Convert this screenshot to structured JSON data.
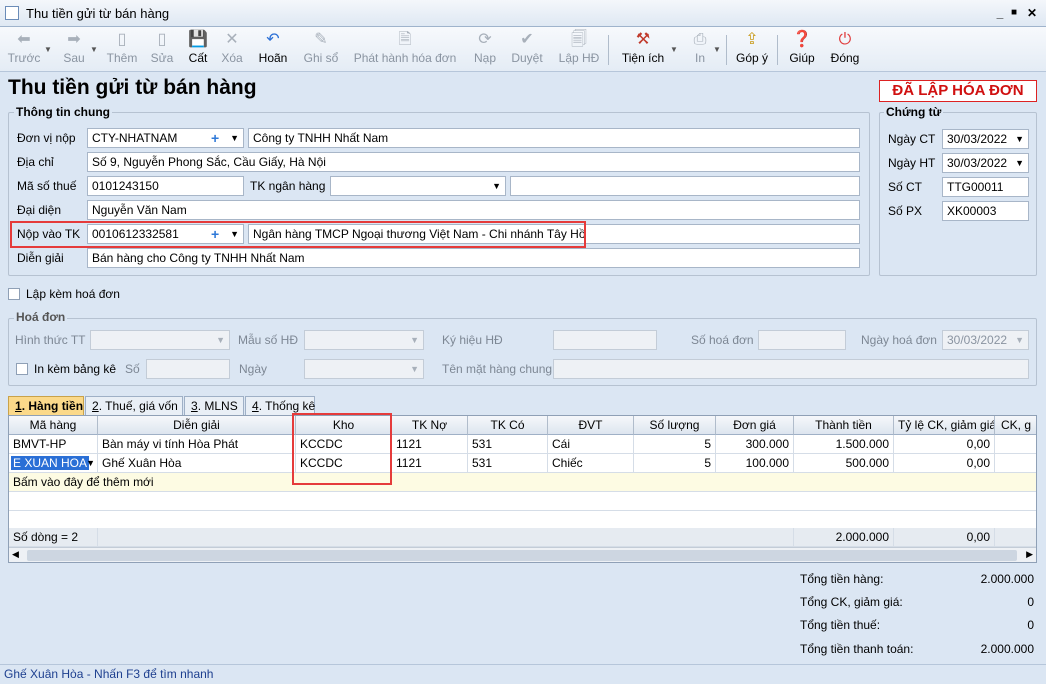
{
  "window": {
    "title": "Thu tiền gửi từ bán hàng",
    "controls": {
      "minimize": "_",
      "maximize": "■",
      "close": "✕"
    }
  },
  "toolbar": {
    "back": "Trước",
    "forward": "Sau",
    "add": "Thêm",
    "edit": "Sửa",
    "save": "Cất",
    "delete": "Xóa",
    "undo": "Hoãn",
    "post": "Ghi sổ",
    "issue_invoice": "Phát hành hóa đơn",
    "reload": "Nạp",
    "approve": "Duyệt",
    "create_invoice": "Lập HĐ",
    "utilities": "Tiện ích",
    "print": "In",
    "feedback": "Góp ý",
    "help": "Giúp",
    "close": "Đóng"
  },
  "page_title": "Thu tiền gửi từ bán hàng",
  "status_stamp": "ĐÃ LẬP HÓA ĐƠN",
  "general": {
    "title": "Thông tin chung",
    "payer_label": "Đơn vị nộp",
    "payer_code": "CTY-NHATNAM",
    "payer_name": "Công ty TNHH Nhất Nam",
    "address_label": "Địa chỉ",
    "address": "Số 9, Nguyễn Phong Sắc, Cầu Giấy, Hà Nội",
    "tax_label": "Mã số thuế",
    "tax_code": "0101243150",
    "bank_label": "TK ngân hàng",
    "bank_account": "",
    "bank_name": "",
    "rep_label": "Đại diện",
    "rep": "Nguyễn Văn Nam",
    "deposit_label": "Nộp vào TK",
    "deposit_account": "0010612332581",
    "deposit_bank": "Ngân hàng TMCP Ngoại thương Việt Nam - Chi nhánh Tây Hồ",
    "desc_label": "Diễn giải",
    "desc": "Bán hàng cho Công ty TNHH Nhất Nam"
  },
  "voucher": {
    "title": "Chứng từ",
    "date_ct_label": "Ngày CT",
    "date_ct": "30/03/2022",
    "date_ht_label": "Ngày HT",
    "date_ht": "30/03/2022",
    "no_ct_label": "Số CT",
    "no_ct": "TTG00011",
    "no_px_label": "Số PX",
    "no_px": "XK00003"
  },
  "invoice_check": "Lập kèm hoá đơn",
  "invoice": {
    "title": "Hoá đơn",
    "payment_label": "Hình thức TT",
    "template_label": "Mẫu số HĐ",
    "symbol_label": "Ký hiệu HĐ",
    "number_label": "Số hoá đơn",
    "date_label": "Ngày hoá đơn",
    "date": "30/03/2022",
    "attach_label": "In kèm bảng kê",
    "so_label": "Số",
    "ngay_label": "Ngày",
    "item_name_label": "Tên mặt hàng chung"
  },
  "tabs": [
    {
      "num": "1",
      "label": ". Hàng tiền"
    },
    {
      "num": "2",
      "label": ". Thuế, giá vốn"
    },
    {
      "num": "3",
      "label": ". MLNS"
    },
    {
      "num": "4",
      "label": ". Thống kê"
    }
  ],
  "table": {
    "headers": [
      "Mã hàng",
      "Diễn giải",
      "Kho",
      "TK Nợ",
      "TK Có",
      "ĐVT",
      "Số lượng",
      "Đơn giá",
      "Thành tiền",
      "Tỷ lệ CK, giảm giá",
      "CK, g"
    ],
    "rows": [
      [
        "BMVT-HP",
        "Bàn máy vi tính Hòa Phát",
        "KCCDC",
        "1121",
        "531",
        "Cái",
        "5",
        "300.000",
        "1.500.000",
        "0,00",
        ""
      ],
      [
        "E XUAN HOA",
        "Ghế Xuân Hòa",
        "KCCDC",
        "1121",
        "531",
        "Chiếc",
        "5",
        "100.000",
        "500.000",
        "0,00",
        ""
      ]
    ],
    "new_row_hint": "Bấm vào đây để thêm mới",
    "row_count": "Số dòng = 2",
    "footer_total": "2.000.000",
    "footer_ratio": "0,00"
  },
  "totals": {
    "goods_label": "Tổng tiền hàng:",
    "goods": "2.000.000",
    "discount_label": "Tổng CK, giảm giá:",
    "discount": "0",
    "tax_label": "Tổng tiền thuế:",
    "tax": "0",
    "pay_label": "Tổng tiền thanh toán:",
    "pay": "2.000.000"
  },
  "status_bar": "Ghế Xuân Hòa - Nhấn F3 để tìm nhanh"
}
